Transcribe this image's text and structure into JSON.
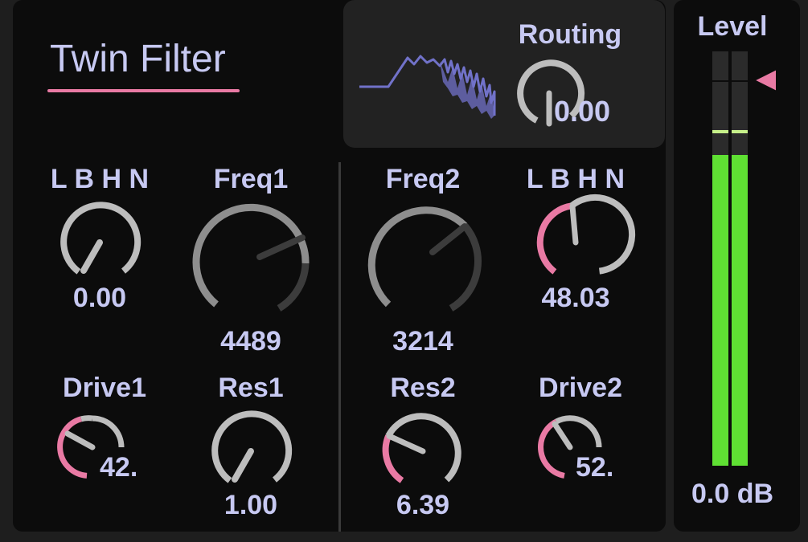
{
  "device": {
    "title": "Twin Filter"
  },
  "routing": {
    "label": "Routing",
    "value": "0.00"
  },
  "filter1": {
    "mode": {
      "label": "L B H N",
      "value": "0.00"
    },
    "freq": {
      "label": "Freq1",
      "value": "4489"
    },
    "drive": {
      "label": "Drive1",
      "value": "42."
    },
    "res": {
      "label": "Res1",
      "value": "1.00"
    }
  },
  "filter2": {
    "freq": {
      "label": "Freq2",
      "value": "3214"
    },
    "mode": {
      "label": "L B H N",
      "value": "48.03"
    },
    "res": {
      "label": "Res2",
      "value": "6.39"
    },
    "drive": {
      "label": "Drive2",
      "value": "52."
    }
  },
  "level": {
    "label": "Level",
    "value": "0.0 dB",
    "meter_fill_fraction": 0.75
  },
  "colors": {
    "text": "#c7c9f2",
    "accent": "#e97aa4",
    "track": "#bdbdbd",
    "spectrum": "#7172c9",
    "meter": "#5fe033"
  },
  "icons": {
    "spectrum": "spectrum-display-icon",
    "level_marker": "triangle-marker-icon"
  }
}
